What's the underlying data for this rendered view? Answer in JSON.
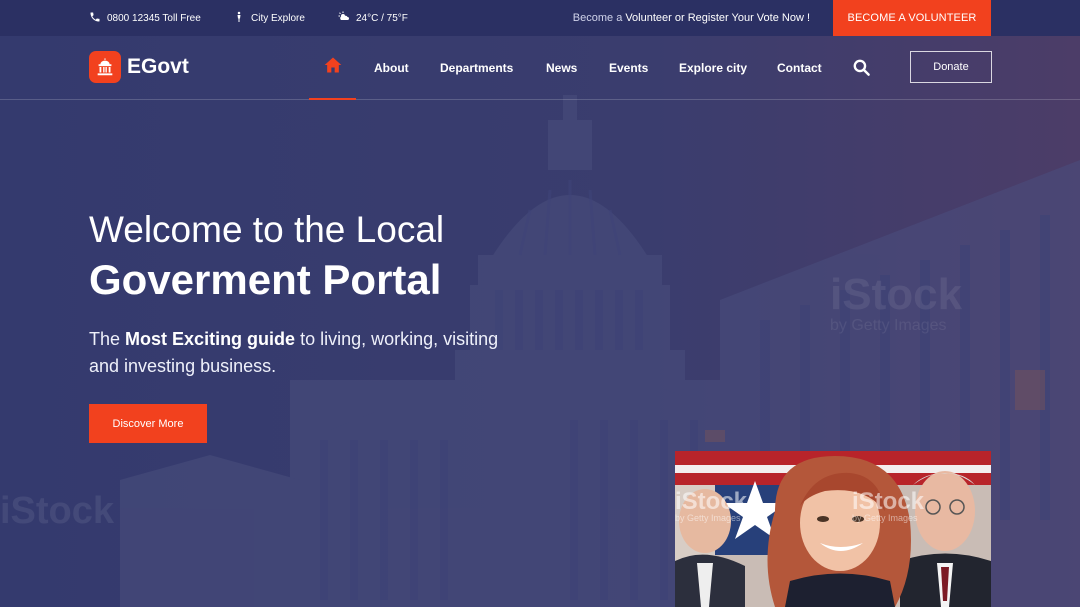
{
  "topbar": {
    "phone": "0800 12345 Toll Free",
    "city": "City Explore",
    "weather": "24°C / 75°F",
    "volunteer_prefix": "Become a",
    "volunteer_bold": "Volunteer or Register Your Vote Now !",
    "become_btn": "BECOME A VOLUNTEER"
  },
  "logo": {
    "text": "EGovt"
  },
  "nav": {
    "items": [
      "About",
      "Departments",
      "News",
      "Events",
      "Explore city",
      "Contact"
    ],
    "donate": "Donate"
  },
  "hero": {
    "line1": "Welcome to the Local",
    "line2": "Goverment Portal",
    "sub_prefix": "The",
    "sub_bold": "Most Exciting guide",
    "sub_rest": "to living, working, visiting and investing business.",
    "cta": "Discover More"
  },
  "watermark": {
    "brand": "iStock",
    "credit": "by Getty Images"
  },
  "colors": {
    "accent": "#f2411e",
    "topbar": "#2b3063",
    "hero": "#353a6b"
  },
  "icons": [
    "phone-icon",
    "person-icon",
    "weather-icon",
    "capitol-icon",
    "home-icon",
    "search-icon"
  ]
}
